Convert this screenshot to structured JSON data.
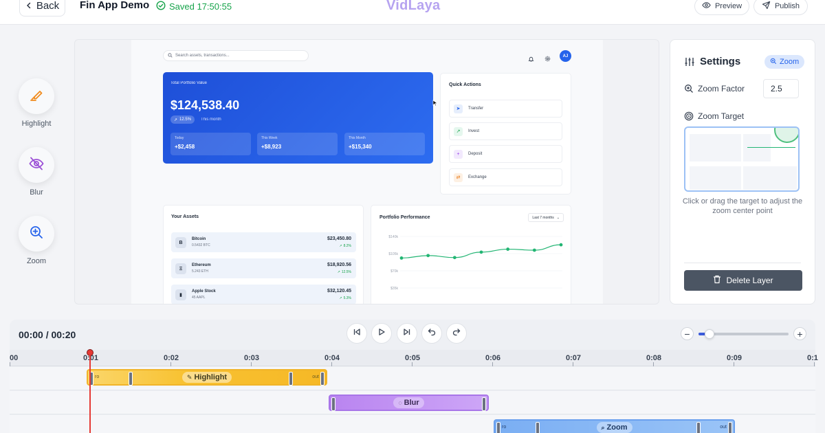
{
  "topbar": {
    "back_label": "Back",
    "project_title": "Fin App Demo",
    "saved_text": "Saved 17:50:55",
    "brand": "VidLaya",
    "preview_label": "Preview",
    "publish_label": "Publish"
  },
  "tools": [
    {
      "label": "Highlight",
      "icon": "highlighter-icon"
    },
    {
      "label": "Blur",
      "icon": "eye-off-icon"
    },
    {
      "label": "Zoom",
      "icon": "zoom-in-icon"
    }
  ],
  "app": {
    "search_placeholder": "Search assets, transactions...",
    "avatar_initials": "AJ",
    "portfolio": {
      "label": "Total Portfolio Value",
      "value": "$124,538.40",
      "change": "12.5%",
      "change_period": "This month",
      "stats": [
        {
          "label": "Today",
          "value": "+$2,458"
        },
        {
          "label": "This Week",
          "value": "+$8,923"
        },
        {
          "label": "This Month",
          "value": "+$15,340"
        }
      ]
    },
    "quick_actions": {
      "title": "Quick Actions",
      "items": [
        "Transfer",
        "Invest",
        "Deposit",
        "Exchange"
      ]
    },
    "assets": {
      "title": "Your Assets",
      "items": [
        {
          "icon": "B",
          "name": "Bitcoin",
          "sub": "0.5432 BTC",
          "value": "$23,450.80",
          "change": "8.2%"
        },
        {
          "icon": "Ξ",
          "name": "Ethereum",
          "sub": "5.243 ETH",
          "value": "$18,920.56",
          "change": "12.5%"
        },
        {
          "icon": "▮",
          "name": "Apple Stock",
          "sub": "45 AAPL",
          "value": "$32,120.45",
          "change": "5.3%"
        }
      ]
    },
    "performance": {
      "title": "Portfolio Performance",
      "range_label": "Last 7 months"
    }
  },
  "chart_data": {
    "type": "line",
    "title": "Portfolio Performance",
    "y_ticks": [
      "$140k",
      "$105k",
      "$70k",
      "$35k",
      "$0k"
    ],
    "ylim": [
      0,
      140
    ],
    "values": [
      96,
      101,
      97,
      108,
      114,
      112,
      123
    ],
    "color": "#22b573"
  },
  "settings": {
    "title": "Settings",
    "badge": "Zoom",
    "zoom_factor_label": "Zoom Factor",
    "zoom_factor_value": "2.5",
    "zoom_target_label": "Zoom Target",
    "hint": "Click or drag the target to adjust the zoom center point",
    "delete_label": "Delete Layer"
  },
  "timeline": {
    "time_display": "00:00 / 00:20",
    "zoom_level": 0.12,
    "playhead": 0.01,
    "ticks": [
      "00",
      "0:01",
      "0:02",
      "0:03",
      "0:04",
      "0:05",
      "0:06",
      "0:07",
      "0:08",
      "0:09",
      "0:1"
    ],
    "clips": [
      {
        "label": "Highlight",
        "in_label": "ro",
        "out_label": "out"
      },
      {
        "label": "Blur"
      },
      {
        "label": "Zoom",
        "in_label": "ro",
        "out_label": "out"
      }
    ]
  },
  "colors": {
    "accent": "#2563eb",
    "brand": "#b6a3f0",
    "highlight_clip": "#f8c232",
    "blur_clip": "#c49af6",
    "zoom_clip": "#86b6f5",
    "playhead": "#e53935",
    "saved": "#16a34a"
  }
}
